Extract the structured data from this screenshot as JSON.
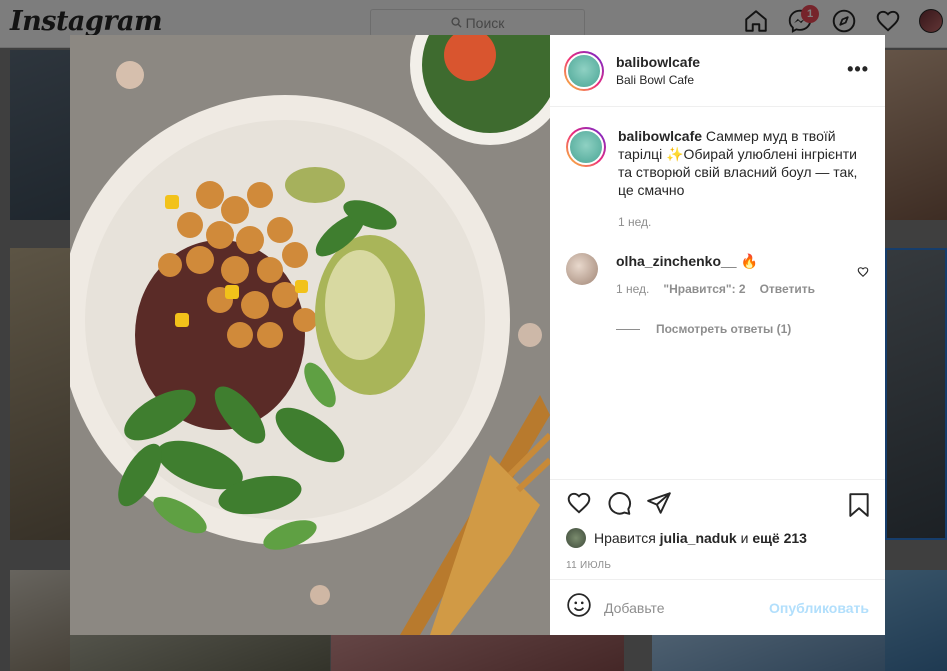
{
  "app": {
    "logo": "Instagram"
  },
  "search": {
    "placeholder": "Поиск"
  },
  "nav": {
    "icons": [
      "home-icon",
      "messenger-icon",
      "explore-icon",
      "heart-icon",
      "avatar"
    ],
    "messenger_badge": "1"
  },
  "post": {
    "username": "balibowlcafe",
    "location": "Bali Bowl Cafe",
    "caption_user": "balibowlcafe",
    "caption_text": "Саммер муд в твоїй тарілці ✨Обирай улюблені інгрієнти та створюй свій власний боул — так, це смачно",
    "caption_time": "1 нед.",
    "comments": [
      {
        "user": "olha_zinchenko__",
        "text": "🔥",
        "time": "1 нед.",
        "likes": "\"Нравится\": 2",
        "reply": "Ответить",
        "view_replies": "Посмотреть ответы (1)"
      }
    ],
    "likes_prefix": "Нравится",
    "likes_user": "julia_naduk",
    "likes_mid": "и",
    "likes_more": "ещё 213",
    "date": "11 ИЮЛЬ",
    "comment_placeholder": "Добавьте",
    "publish_label": "Опубликовать"
  },
  "colors": {
    "accent": "#0095f6",
    "publish_disabled": "#b2dffc",
    "badge": "#ed4956"
  }
}
